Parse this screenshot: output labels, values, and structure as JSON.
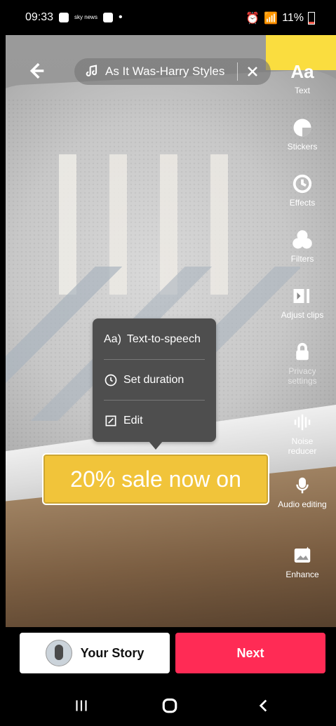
{
  "status": {
    "time": "09:33",
    "left_icons": [
      "phone-lock-icon",
      "sky-news-icon",
      "instagram-icon",
      "dot-icon"
    ],
    "sky_text": "sky news",
    "battery": "11%"
  },
  "top": {
    "music_title": "As It Was-Harry Styles"
  },
  "tools": [
    {
      "label": "Text",
      "icon": "text-aa-icon"
    },
    {
      "label": "Stickers",
      "icon": "sticker-icon"
    },
    {
      "label": "Effects",
      "icon": "effects-clock-icon"
    },
    {
      "label": "Filters",
      "icon": "filters-circles-icon"
    },
    {
      "label": "Adjust clips",
      "icon": "adjust-clips-icon"
    },
    {
      "label": "Privacy settings",
      "icon": "lock-icon"
    },
    {
      "label": "Noise reducer",
      "icon": "noise-reducer-icon"
    },
    {
      "label": "Audio editing",
      "icon": "audio-editing-icon"
    },
    {
      "label": "Enhance",
      "icon": "enhance-icon"
    }
  ],
  "menu": {
    "items": [
      "Text-to-speech",
      "Set duration",
      "Edit"
    ]
  },
  "sticker_text": "20% sale now on",
  "bottom": {
    "your_story": "Your Story",
    "next": "Next"
  },
  "colors": {
    "next_bg": "#ff2b55",
    "sticker_bg": "#f1c43a"
  }
}
